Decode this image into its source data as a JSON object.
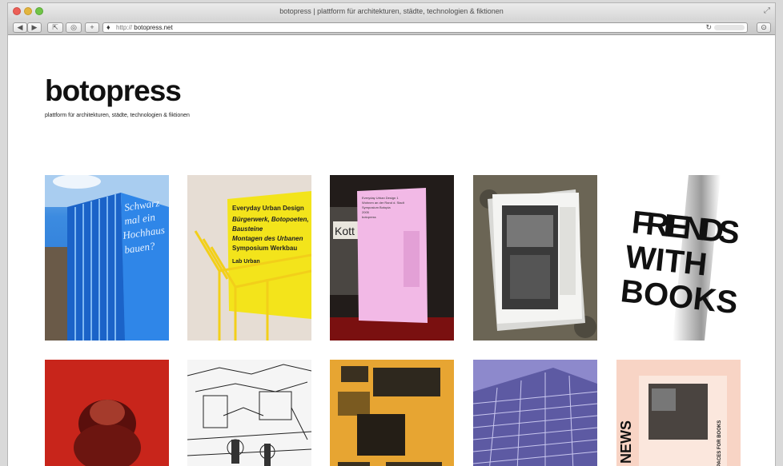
{
  "browser": {
    "window_title": "botopress | plattform für architekturen, städte, technologien & fiktionen",
    "url_scheme": "http://",
    "url_host": "botopress.net",
    "back_icon": "back-arrow-icon",
    "forward_icon": "forward-arrow-icon"
  },
  "site": {
    "title": "botopress",
    "subtitle": "plattform für architekturen, städte, technologien & fiktionen"
  },
  "tiles": [
    {
      "name": "tile-blue-book-stack",
      "text": "Schwarz mal ein Hochhaus bauen?",
      "color": "#2a78d6"
    },
    {
      "name": "tile-yellow-book",
      "text_lines": [
        "Everyday Urban Design",
        "Bürgerwerk, Botopoeten,",
        "Bausteine",
        "Montagen des Urbanen",
        "Symposium Werkbau",
        "Lab Urban"
      ],
      "color": "#f2e21a"
    },
    {
      "name": "tile-pink-book",
      "text_lines": [
        "Everyday Urban Design 1",
        "Wohnen an der Rand d. Stadt",
        "Symposium Botopia",
        "2005",
        "botopress"
      ],
      "sign": "Kott",
      "color": "#f1b8e3"
    },
    {
      "name": "tile-bw-magazine",
      "color": "#5a564c"
    },
    {
      "name": "tile-friends-with-books",
      "text_lines": [
        "FRIENDS",
        "WITH",
        "BOOKS"
      ],
      "color": "#111111"
    },
    {
      "name": "tile-red-marx-poster",
      "color": "#c8251b"
    },
    {
      "name": "tile-sketch-drawing",
      "color": "#f3f3f3"
    },
    {
      "name": "tile-ochre-collage",
      "color": "#e6a634"
    },
    {
      "name": "tile-violet-building",
      "color": "#8c88c9"
    },
    {
      "name": "tile-peach-news",
      "text_lines": [
        "NEWS",
        "SPACES FOR BOOKS"
      ],
      "color": "#f7d3c4"
    }
  ]
}
